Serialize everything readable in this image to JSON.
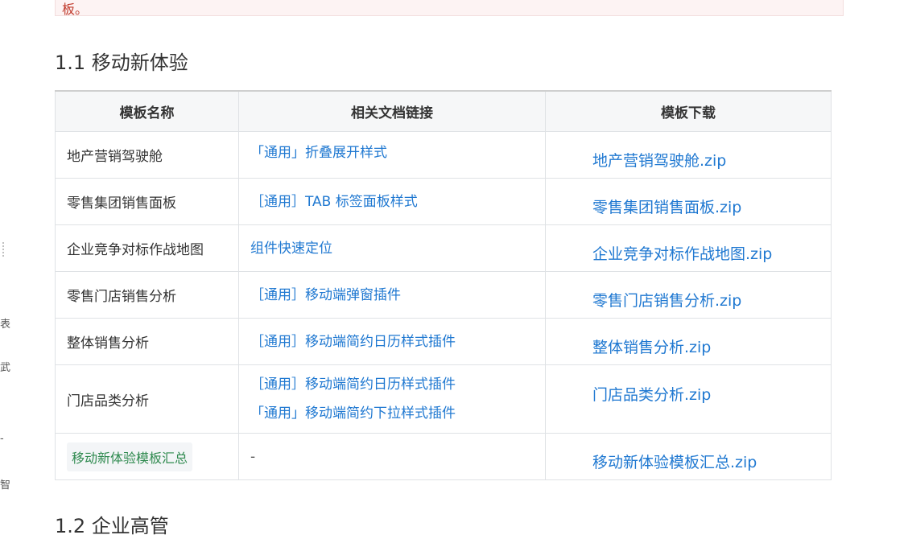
{
  "note": {
    "text": "板。"
  },
  "section1": {
    "title": "1.1 移动新体验"
  },
  "section2": {
    "title": "1.2 企业高管"
  },
  "left_fragments": [
    "表",
    "武",
    "-",
    "智"
  ],
  "table": {
    "headers": [
      "模板名称",
      "相关文档链接",
      "模板下载"
    ],
    "rows": [
      {
        "name": "地产营销驾驶舱",
        "docs": [
          "「通用」折叠展开样式"
        ],
        "download": "地产营销驾驶舱.zip"
      },
      {
        "name": "零售集团销售面板",
        "docs": [
          "［通用］TAB 标签面板样式"
        ],
        "download": "零售集团销售面板.zip"
      },
      {
        "name": "企业竞争对标作战地图",
        "docs": [
          "组件快速定位"
        ],
        "download": "企业竞争对标作战地图.zip"
      },
      {
        "name": "零售门店销售分析",
        "docs": [
          "［通用］移动端弹窗插件"
        ],
        "download": "零售门店销售分析.zip"
      },
      {
        "name": "整体销售分析",
        "docs": [
          "［通用］移动端简约日历样式插件"
        ],
        "download": "整体销售分析.zip"
      },
      {
        "name": "门店品类分析",
        "docs": [
          "［通用］移动端简约日历样式插件",
          "「通用」移动端简约下拉样式插件"
        ],
        "download": "门店品类分析.zip"
      },
      {
        "name": "移动新体验模板汇总",
        "docs": [
          "-"
        ],
        "download": "移动新体验模板汇总.zip"
      }
    ]
  },
  "colors": {
    "link": "#1f78d1",
    "tag_text": "#2f8a4f",
    "note_text": "#c0392b"
  }
}
